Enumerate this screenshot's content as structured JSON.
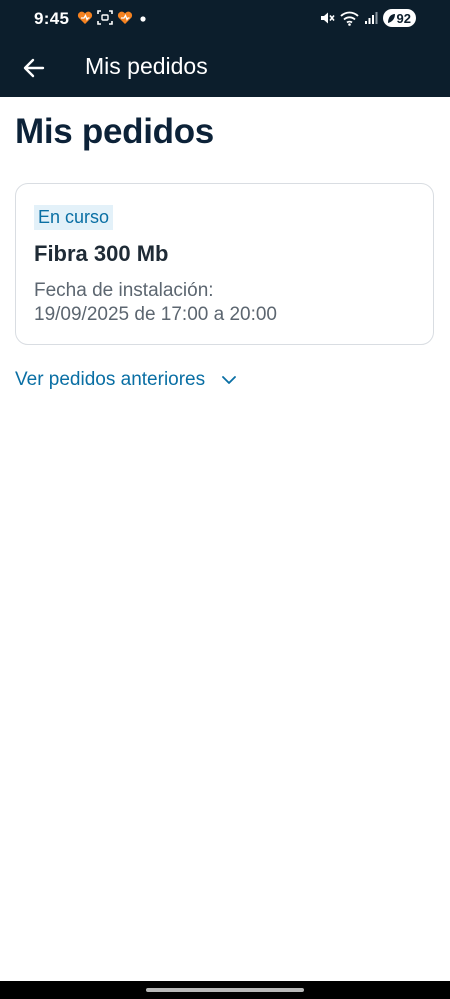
{
  "status_bar": {
    "time": "9:45",
    "battery_level": "92",
    "notification_icons": [
      "heart-badge-icon",
      "screenshot-icon",
      "heart-badge-icon",
      "dot-icon"
    ],
    "system_icons": [
      "mute-icon",
      "wifi-icon",
      "signal-icon",
      "battery-icon"
    ],
    "accent_color": "#f58220"
  },
  "app_bar": {
    "title": "Mis pedidos",
    "back_icon": "arrow-left-icon",
    "background": "#0c1e2c"
  },
  "page": {
    "title": "Mis pedidos"
  },
  "orders": [
    {
      "status": "En curso",
      "product": "Fibra 300 Mb",
      "install_label": "Fecha de instalación:",
      "install_date": "19/09/2025 de 17:00 a 20:00"
    }
  ],
  "previous_orders": {
    "label": "Ver pedidos anteriores",
    "icon": "chevron-down-icon",
    "color": "#0a6fa4"
  }
}
